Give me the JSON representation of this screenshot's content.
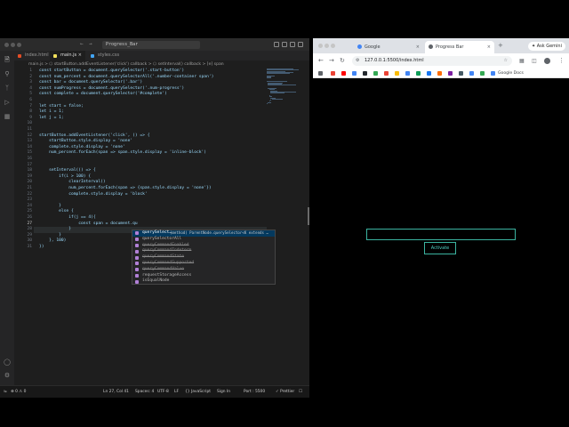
{
  "vscode": {
    "search": "Progress_Bar",
    "tabs": [
      {
        "label": "index.html",
        "color": "#e44d26"
      },
      {
        "label": "main.js",
        "color": "#f1e05a"
      },
      {
        "label": "styles.css",
        "color": "#42a5f5"
      }
    ],
    "breadcrumb": "main.js > ⬡ startButton.addEventListener('click') callback > ⬡ setInterval() callback > [e] span",
    "line_numbers": [
      "1",
      "2",
      "3",
      "4",
      "5",
      "6",
      "7",
      "8",
      "9",
      "10",
      "11",
      "12",
      "13",
      "14",
      "15",
      "16",
      "17",
      "18",
      "19",
      "20",
      "21",
      "22",
      "23",
      "24",
      "25",
      "26",
      "27",
      "28",
      "29",
      "30",
      "31"
    ],
    "current_line": "27",
    "code": [
      "const startButton = document.querySelector('.start-button')",
      "const num_percent = document.querySelectorAll('.number-container span')",
      "const bar = document.querySelector('.bar')",
      "const numProgress = document.querySelector('.num-progress')",
      "const complete = document.querySelector('#complete')",
      "",
      "let start = false;",
      "let i = 1;",
      "let j = 1;",
      "",
      "",
      "startButton.addEventListener('click', () => {",
      "    startButton.style.display = 'none'",
      "    complete.style.display = 'none'",
      "    num_percent.forEach(span => span.style.display = 'inline-block')",
      "",
      "",
      "    setInterval(() => {",
      "        if(i > 100) {",
      "            clearInterval()",
      "            num_percent.forEach(span => {span.style.display = 'none'})",
      "            complete.style.display = 'block'",
      "",
      "        }",
      "        else {",
      "            if(j == 4){",
      "                const span = document.qu",
      "            }",
      "        }",
      "    }, 100)",
      "})"
    ],
    "suggestions": [
      {
        "label": "querySelect…",
        "detail": "(method) ParentNode.querySelector<K extends …",
        "selected": true,
        "deprecated": false
      },
      {
        "label": "querySelectorAll",
        "detail": "",
        "selected": false,
        "deprecated": false
      },
      {
        "label": "queryCommandEnabled",
        "detail": "",
        "selected": false,
        "deprecated": true
      },
      {
        "label": "queryCommandIndeterm",
        "detail": "",
        "selected": false,
        "deprecated": true
      },
      {
        "label": "queryCommandState",
        "detail": "",
        "selected": false,
        "deprecated": true
      },
      {
        "label": "queryCommandSupported",
        "detail": "",
        "selected": false,
        "deprecated": true
      },
      {
        "label": "queryCommandValue",
        "detail": "",
        "selected": false,
        "deprecated": true
      },
      {
        "label": "requestStorageAccess",
        "detail": "",
        "selected": false,
        "deprecated": false
      },
      {
        "label": "isEqualNode",
        "detail": "",
        "selected": false,
        "deprecated": false
      }
    ],
    "status": {
      "position": "Ln 27, Col 41",
      "spaces": "Spaces: 4",
      "encoding": "UTF-8",
      "eol": "LF",
      "language": "{} JavaScript",
      "signin": "Sign In",
      "port": "Port : 5500",
      "prettier": "✓ Prettier"
    }
  },
  "chrome": {
    "tabs": [
      {
        "label": "Google",
        "favicon": "#4285f4"
      },
      {
        "label": "Progress Bar",
        "favicon": "#5f6368"
      }
    ],
    "ask_gemini": "✦ Ask Gemini",
    "url": "127.0.0.1:5500/index.html",
    "bookmarks_label": "Google Docs",
    "activate_label": "Activate",
    "accent": "#3bb3a0"
  }
}
